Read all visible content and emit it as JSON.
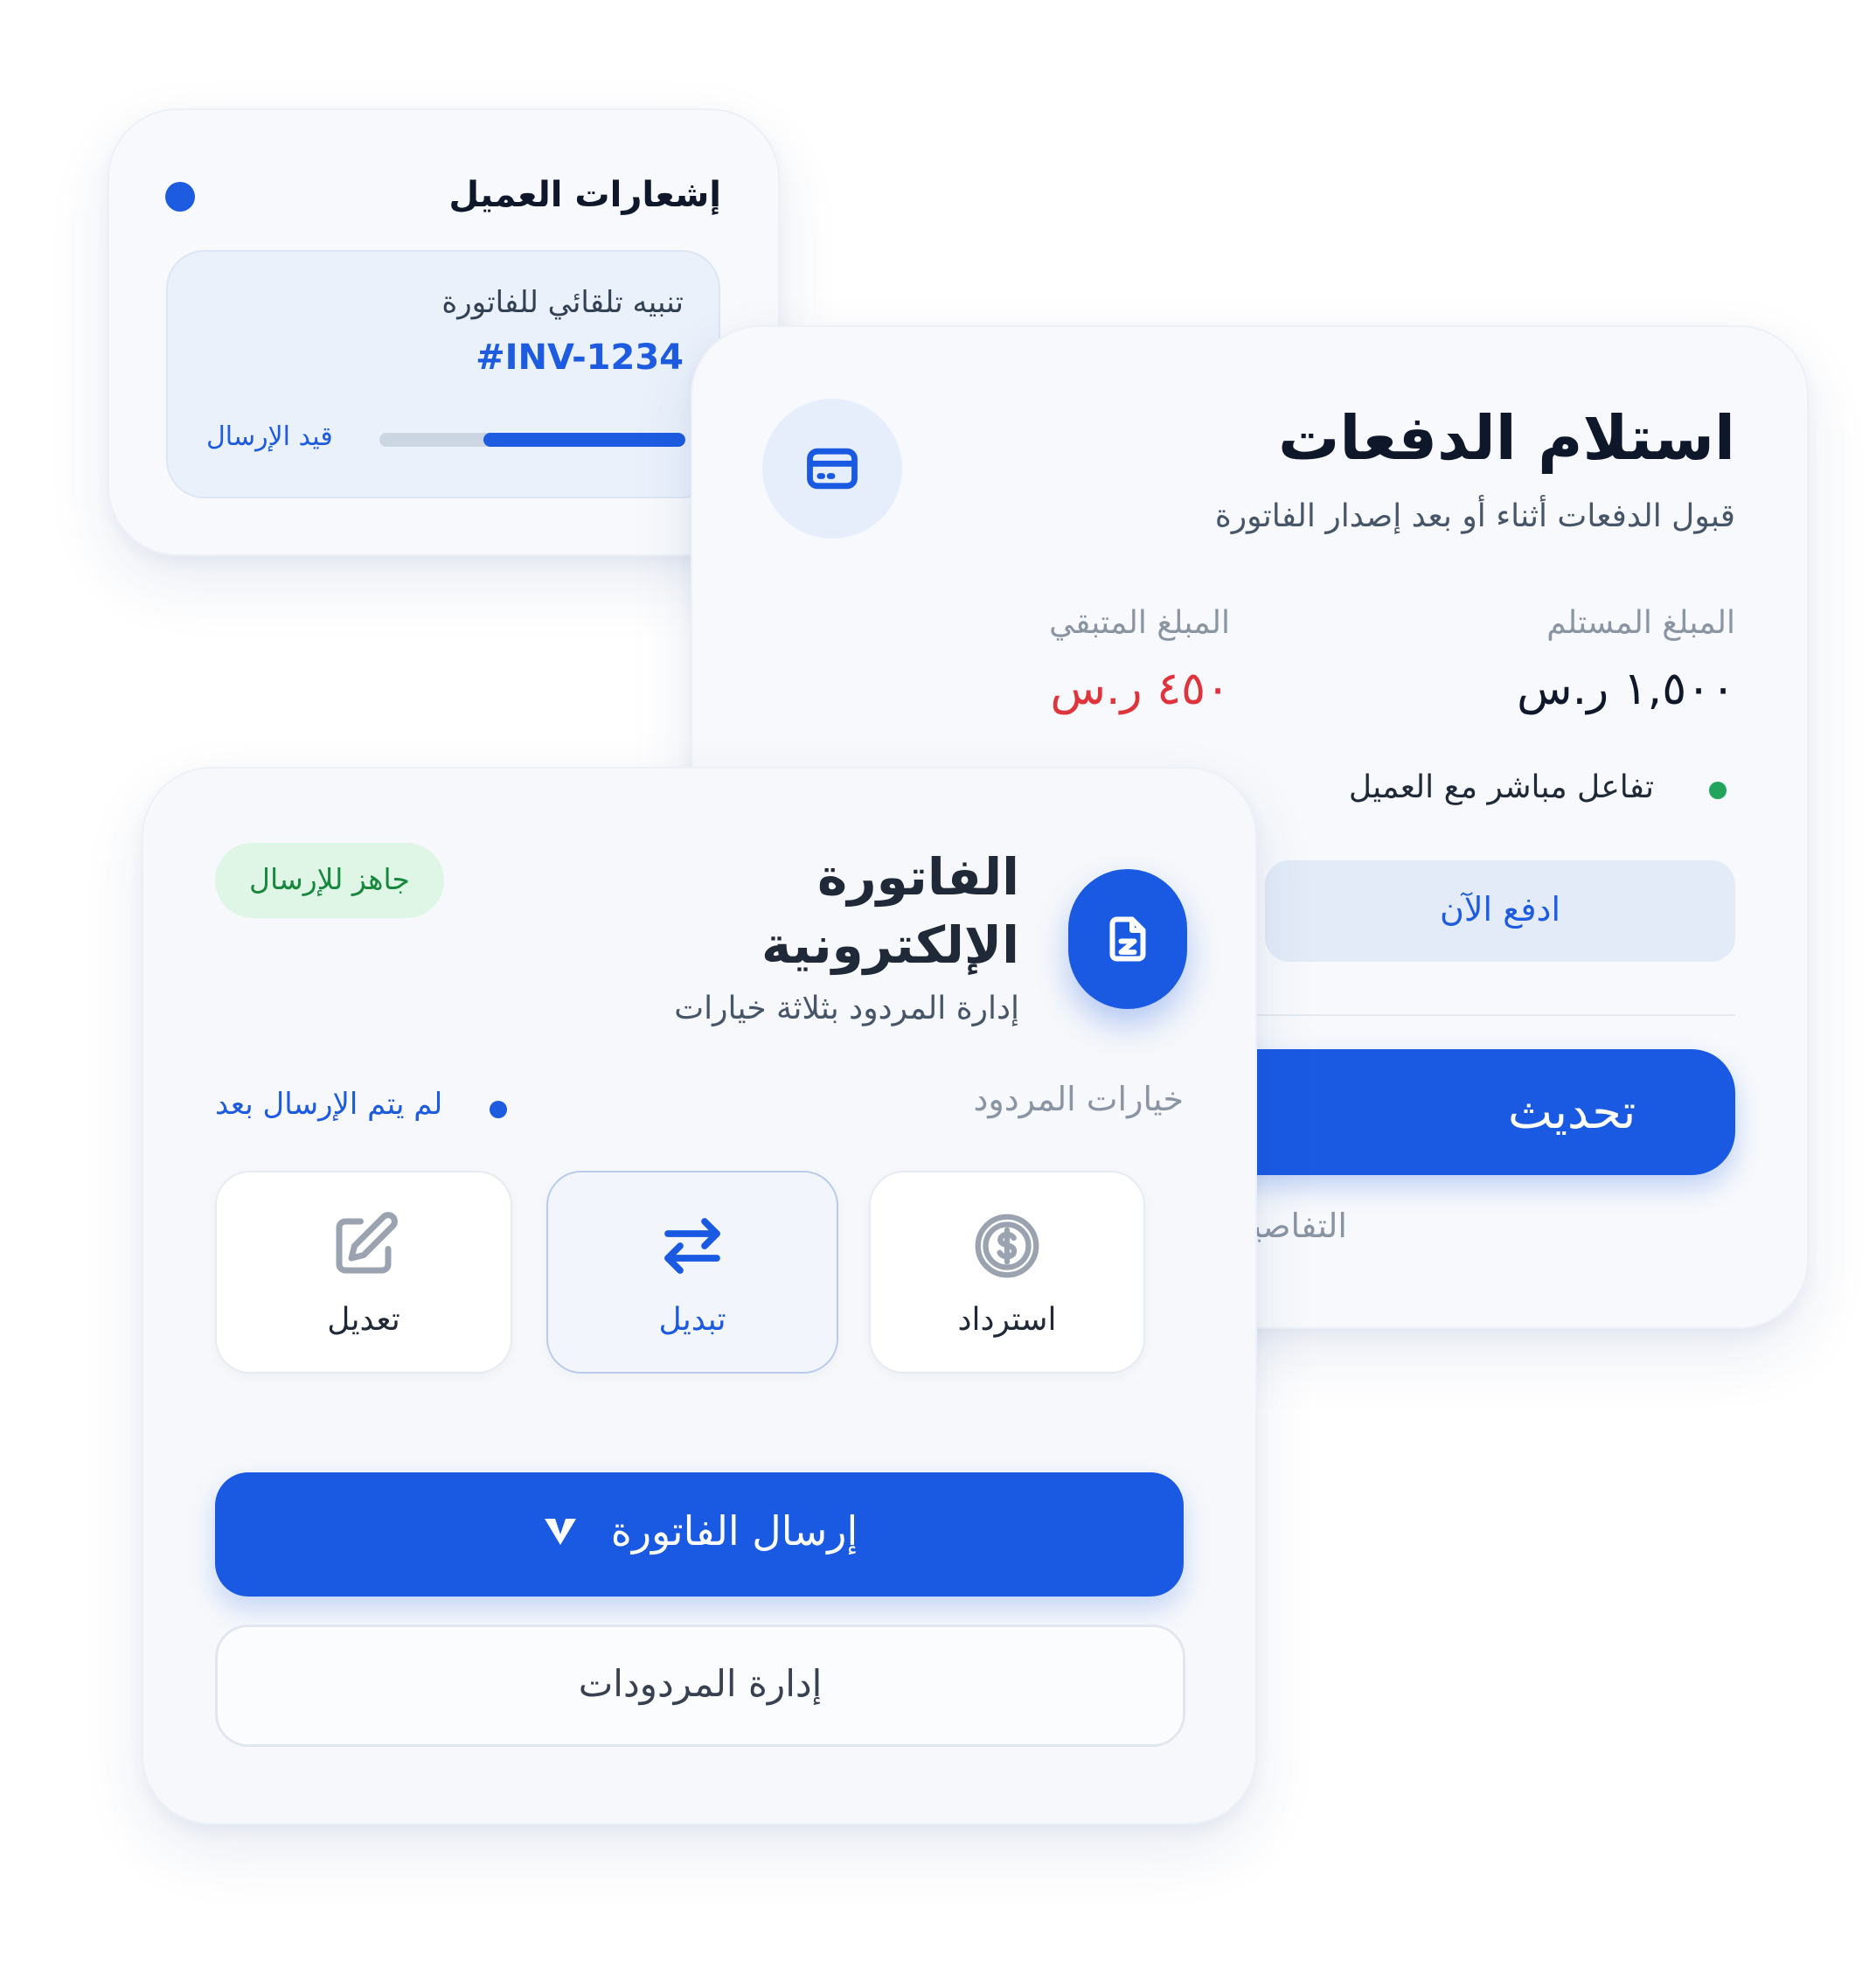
{
  "notification_card": {
    "title": "إشعارات العميل",
    "alert_text": "تنبيه تلقائي للفاتورة",
    "invoice_number": "#INV-1234",
    "progress_label": "قيد الإرسال",
    "progress_fraction": 0.66
  },
  "payment_card": {
    "title": "استلام الدفعات",
    "subtitle": "قبول الدفعات أثناء أو بعد إصدار الفاتورة",
    "received_label": "المبلغ المستلم",
    "received_value": "١,٥٠٠ ر.س",
    "remaining_label": "المبلغ المتبقي",
    "remaining_value": "٤٥٠ ر.س",
    "live_status": "تفاعل مباشر مع العميل",
    "pay_now_label": "ادفع الآن",
    "update_label": "تحديث",
    "details_label": "التفاصيل"
  },
  "invoice_card": {
    "title_line1": "الفاتورة",
    "title_line2": "الإلكترونية",
    "subtitle": "إدارة المردود بثلاثة خيارات",
    "ready_badge": "جاهز للإرسال",
    "options_label": "خيارات المردود",
    "not_sent_status": "لم يتم الإرسال بعد",
    "options": [
      {
        "label": "استرداد",
        "icon": "dollar-circle-icon"
      },
      {
        "label": "تبديل",
        "icon": "swap-arrows-icon"
      },
      {
        "label": "تعديل",
        "icon": "edit-icon"
      }
    ],
    "send_label": "إرسال الفاتورة",
    "manage_label": "إدارة المردودات"
  },
  "colors": {
    "primary": "#1a5ae3",
    "danger": "#e0343c",
    "success_dot": "#22a45d",
    "badge_bg": "#dff6e6",
    "badge_text": "#18883f",
    "muted": "#8a94a3"
  }
}
